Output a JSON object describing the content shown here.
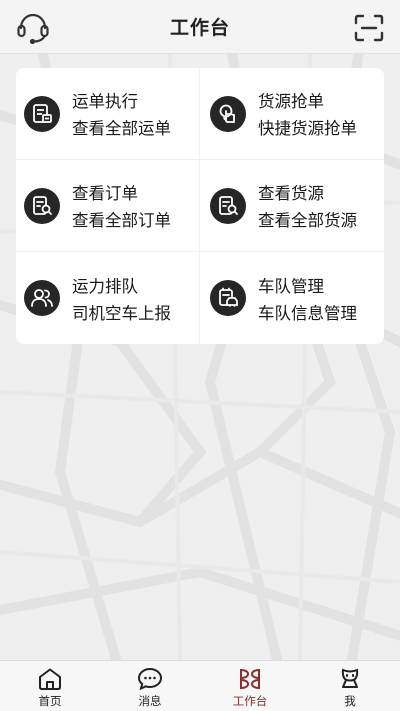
{
  "header": {
    "title": "工作台",
    "left_icon": "headset-icon",
    "right_icon": "scan-icon"
  },
  "menu": [
    {
      "title": "运单执行",
      "subtitle": "查看全部运单",
      "icon": "waybill-icon"
    },
    {
      "title": "货源抢单",
      "subtitle": "快捷货源抢单",
      "icon": "grab-order-icon"
    },
    {
      "title": "查看订单",
      "subtitle": "查看全部订单",
      "icon": "order-search-icon"
    },
    {
      "title": "查看货源",
      "subtitle": "查看全部货源",
      "icon": "cargo-search-icon"
    },
    {
      "title": "运力排队",
      "subtitle": "司机空车上报",
      "icon": "drivers-icon"
    },
    {
      "title": "车队管理",
      "subtitle": "车队信息管理",
      "icon": "fleet-icon"
    }
  ],
  "tabbar": {
    "active_index": 2,
    "active_color": "#8b2e2e",
    "tabs": [
      {
        "label": "首页",
        "icon": "home-icon"
      },
      {
        "label": "消息",
        "icon": "message-icon"
      },
      {
        "label": "工作台",
        "icon": "workbench-icon"
      },
      {
        "label": "我",
        "icon": "profile-icon"
      }
    ]
  }
}
